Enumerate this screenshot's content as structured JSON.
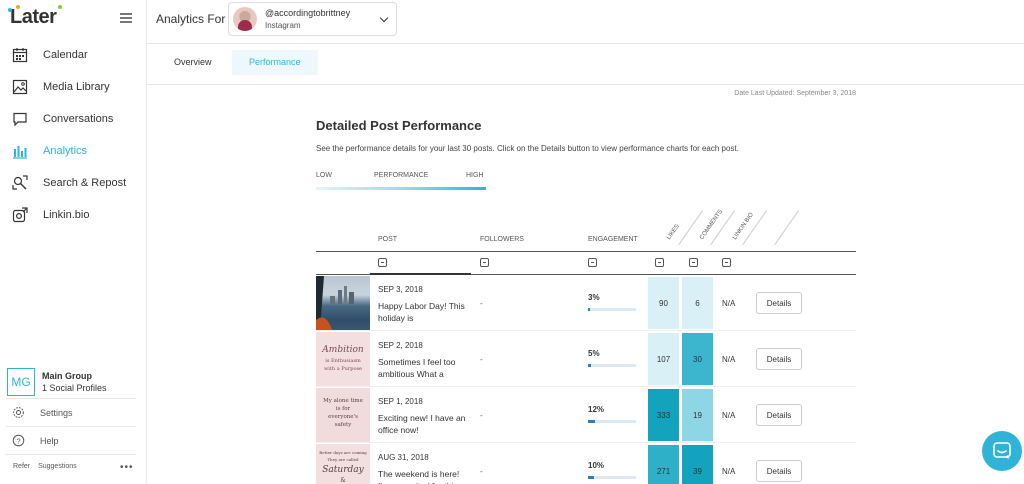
{
  "brand": {
    "name": "Later",
    "accent": "#2fb4d8"
  },
  "sidebar": {
    "items": [
      {
        "label": "Calendar",
        "icon": "calendar-icon"
      },
      {
        "label": "Media Library",
        "icon": "image-icon"
      },
      {
        "label": "Conversations",
        "icon": "chat-icon"
      },
      {
        "label": "Analytics",
        "icon": "bar-chart-icon",
        "active": true
      },
      {
        "label": "Search & Repost",
        "icon": "search-repost-icon"
      },
      {
        "label": "Linkin.bio",
        "icon": "link-icon"
      }
    ],
    "group": {
      "initials": "MG",
      "name": "Main Group",
      "profiles": "1 Social Profiles"
    },
    "settings": "Settings",
    "help": "Help",
    "refer": "Refer",
    "suggestions": "Suggestions",
    "more": "•••"
  },
  "header": {
    "title": "Analytics For",
    "account": {
      "handle": "@accordingtobrittney",
      "network": "Instagram"
    }
  },
  "tabs": [
    {
      "label": "Overview",
      "active": false
    },
    {
      "label": "Performance",
      "active": true
    }
  ],
  "date_updated": "Date Last Updated: September 3, 2018",
  "section": {
    "title": "Detailed Post Performance",
    "description": "See the performance details for your last 30 posts. Click on the Details button to view performance charts for each post."
  },
  "legend": {
    "low": "LOW",
    "mid": "PERFORMANCE",
    "high": "HIGH"
  },
  "table": {
    "columns": {
      "post": "POST",
      "followers": "FOLLOWERS",
      "engagement": "ENGAGEMENT",
      "likes": "LIKES",
      "comments": "COMMENTS",
      "linkinbio": "LINKIN.BIO"
    },
    "rows": [
      {
        "date": "SEP 3, 2018",
        "caption": "Happy Labor Day! This holiday is",
        "followers": "-",
        "engagement": "3%",
        "engagement_value": 0.03,
        "likes": "90",
        "likes_color": "#d9f0f7",
        "comments": "6",
        "comments_color": "#d9f0f7",
        "linkinbio": "N/A",
        "details": "Details"
      },
      {
        "date": "SEP 2, 2018",
        "caption": "Sometimes I feel too ambitious What a",
        "followers": "-",
        "engagement": "5%",
        "engagement_value": 0.05,
        "likes": "107",
        "likes_color": "#d9f0f7",
        "comments": "30",
        "comments_color": "#3cb5cf",
        "linkinbio": "N/A",
        "details": "Details",
        "thumb_text": [
          "Ambition",
          "is Enthusiasm",
          "with a Purpose"
        ]
      },
      {
        "date": "SEP 1, 2018",
        "caption": "Exciting new! I have an office now!",
        "followers": "-",
        "engagement": "12%",
        "engagement_value": 0.12,
        "likes": "333",
        "likes_color": "#13a3bd",
        "comments": "19",
        "comments_color": "#8ed5e6",
        "linkinbio": "N/A",
        "details": "Details",
        "thumb_text": [
          "My alone time",
          "is for",
          "everyone's",
          "safety"
        ]
      },
      {
        "date": "AUG 31, 2018",
        "caption": "The weekend is here! I'm so excited for this",
        "followers": "-",
        "engagement": "10%",
        "engagement_value": 0.1,
        "likes": "271",
        "likes_color": "#2fb0c9",
        "comments": "39",
        "comments_color": "#13a3bd",
        "linkinbio": "N/A",
        "details": "Details",
        "thumb_text": [
          "Better days are coming",
          "They are called",
          "Saturday",
          "&"
        ]
      }
    ]
  }
}
